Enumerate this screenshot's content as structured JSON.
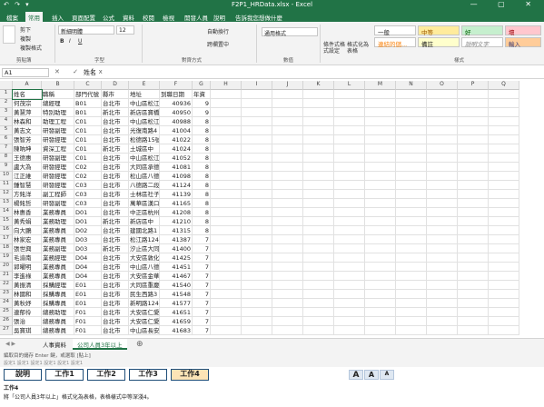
{
  "window": {
    "title": "F2P1_HRData.xlsx - Excel",
    "quick_access": "↶ ↷ ▾",
    "controls": "— ▢ ✕"
  },
  "ribbon_tabs": [
    "檔案",
    "常用",
    "插入",
    "頁面配置",
    "公式",
    "資料",
    "校閱",
    "檢視",
    "開發人員",
    "說明",
    "告訴我您想做什麼"
  ],
  "ribbon": {
    "clipboard": {
      "cut": "剪下",
      "copy": "複製",
      "format_painter": "複製格式",
      "label": "剪貼簿"
    },
    "font": {
      "name": "新細明體",
      "size": "12",
      "bold": "B",
      "italic": "I",
      "underline": "U",
      "label": "字型"
    },
    "alignment": {
      "wrap": "自動換行",
      "merge": "跨欄置中",
      "label": "對齊方式"
    },
    "number": {
      "format": "通用格式",
      "label": "數值"
    },
    "conditional": "條件式格式設定",
    "format_as_table": "格式化為表格",
    "styles": {
      "label": "樣式",
      "items": [
        {
          "text": "一般",
          "bg": "#ffffff",
          "fg": "#222222"
        },
        {
          "text": "中等",
          "bg": "#ffeb9c",
          "fg": "#9c5700"
        },
        {
          "text": "好",
          "bg": "#c6efce",
          "fg": "#006100"
        },
        {
          "text": "壞",
          "bg": "#ffc7ce",
          "fg": "#9c0006"
        },
        {
          "text": "連結的儲...",
          "bg": "#ffffff",
          "fg": "#fa7d00"
        },
        {
          "text": "備註",
          "bg": "#ffffcc",
          "fg": "#222222"
        },
        {
          "text": "說明文字",
          "bg": "#ffffff",
          "fg": "#7f7f7f"
        },
        {
          "text": "輸入",
          "bg": "#ffcc99",
          "fg": "#3f3f76"
        }
      ]
    }
  },
  "formula_bar": {
    "name_box": "A1",
    "fx": "✕ ✓ fx",
    "content": "姓名"
  },
  "columns": [
    "A",
    "B",
    "C",
    "D",
    "E",
    "F",
    "G",
    "H",
    "I",
    "J",
    "K",
    "L",
    "M",
    "N",
    "O",
    "P",
    "Q"
  ],
  "table": {
    "headers": [
      "姓名",
      "職稱",
      "部門代號",
      "縣市",
      "地址",
      "到職日期",
      "年資"
    ],
    "rows": [
      [
        "何茂宗",
        "總經理",
        "B01",
        "台北市",
        "中山區松江",
        "40936",
        "9"
      ],
      [
        "黃慧萍",
        "特別助理",
        "B01",
        "新北市",
        "新店區寶橋",
        "40950",
        "9"
      ],
      [
        "林森和",
        "助理工程",
        "C01",
        "台北市",
        "中山區松江",
        "40988",
        "8"
      ],
      [
        "黃志文",
        "研發副理",
        "C01",
        "台北市",
        "光復南路4",
        "41004",
        "8"
      ],
      [
        "張智芳",
        "研發經理",
        "C01",
        "台北市",
        "松德路15號",
        "41022",
        "8"
      ],
      [
        "陳吶坤",
        "資深工程",
        "C01",
        "新北市",
        "土城區中",
        "41024",
        "8"
      ],
      [
        "王德惠",
        "研發副理",
        "C01",
        "台北市",
        "中山區松江",
        "41052",
        "8"
      ],
      [
        "盧大為",
        "研發經理",
        "C02",
        "台北市",
        "大同區承德",
        "41081",
        "8"
      ],
      [
        "江正維",
        "研發經理",
        "C02",
        "台北市",
        "松山區八德",
        "41098",
        "8"
      ],
      [
        "鍾智慧",
        "研發經理",
        "C03",
        "台北市",
        "八德路二段",
        "41124",
        "8"
      ],
      [
        "方銘洋",
        "副工程師",
        "C03",
        "台北市",
        "士林區社子",
        "41139",
        "8"
      ],
      [
        "楊銘哲",
        "研發副理",
        "C03",
        "台北市",
        "萬華區漢口",
        "41165",
        "8"
      ],
      [
        "林惠香",
        "業務專員",
        "D01",
        "台北市",
        "中正區杭州",
        "41208",
        "8"
      ],
      [
        "黃秀娟",
        "業務助理",
        "D01",
        "新北市",
        "新店區中",
        "41210",
        "8"
      ],
      [
        "向大鵬",
        "業務專員",
        "D02",
        "台北市",
        "建國北路1",
        "41315",
        "8"
      ],
      [
        "林家宏",
        "業務專員",
        "D03",
        "台北市",
        "松江路124",
        "41387",
        "7"
      ],
      [
        "張世興",
        "業務副理",
        "D03",
        "新北市",
        "汐止區大同",
        "41400",
        "7"
      ],
      [
        "毛渝南",
        "業務經理",
        "D04",
        "台北市",
        "大安區敦化",
        "41425",
        "7"
      ],
      [
        "郭曜明",
        "業務專員",
        "D04",
        "台北市",
        "中山區八德",
        "41451",
        "7"
      ],
      [
        "李進祿",
        "業務專員",
        "D04",
        "台北市",
        "大安區金華",
        "41467",
        "7"
      ],
      [
        "黃振清",
        "採購經理",
        "E01",
        "台北市",
        "大同區重慶",
        "41540",
        "7"
      ],
      [
        "林國和",
        "採購專員",
        "E01",
        "台北市",
        "民生西路3",
        "41548",
        "7"
      ],
      [
        "黃秋妤",
        "採購專員",
        "E01",
        "台北市",
        "新明路124",
        "41577",
        "7"
      ],
      [
        "連郁伶",
        "總務助理",
        "F01",
        "台北市",
        "大安區仁愛",
        "41651",
        "7"
      ],
      [
        "張治",
        "總務專員",
        "F01",
        "台北市",
        "大安區仁愛",
        "41659",
        "7"
      ],
      [
        "吳寶琪",
        "總務專員",
        "F01",
        "台北市",
        "中山區長安",
        "41683",
        "7"
      ]
    ]
  },
  "sheets": [
    "人事資料",
    "公司人員3年以上"
  ],
  "status": {
    "line1": "編取目的儲存 Enter 鍵，或選取 [貼上]",
    "line2": "設定1   設定1   設定1   設定1   設定1   設定1"
  },
  "tasks": [
    "說明",
    "工作1",
    "工作2",
    "工作3",
    "工作4"
  ],
  "zoom_buttons": [
    "A",
    "A",
    "A"
  ],
  "task_heading": "工作4",
  "task_description": "將「公司人員3年以上」格式化為表格，表格樣式中等深淺4。"
}
